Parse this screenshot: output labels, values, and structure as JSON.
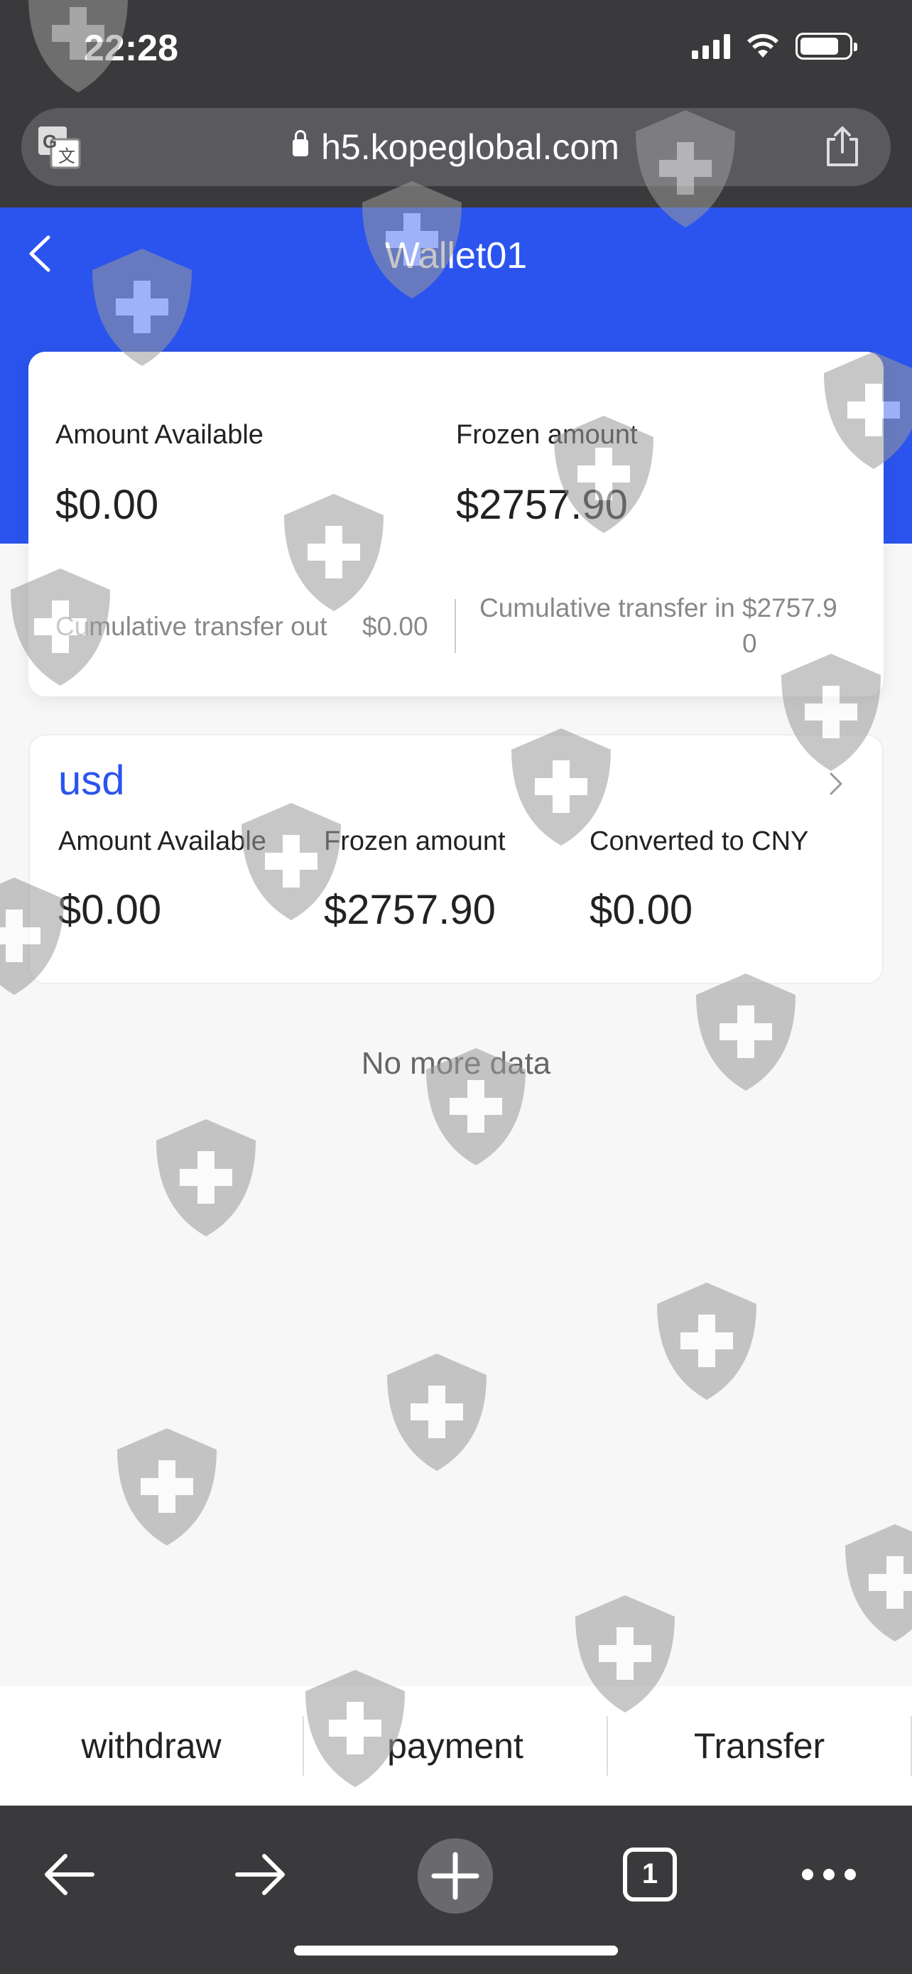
{
  "status_bar": {
    "time": "22:28"
  },
  "browser": {
    "url": "h5.kopeglobal.com",
    "tab_count": "1"
  },
  "header": {
    "title": "Wallet01"
  },
  "summary": {
    "available_label": "Amount Available",
    "available_value": "$0.00",
    "frozen_label": "Frozen amount",
    "frozen_value": "$2757.90",
    "transfer_out_label": "Cumulative transfer out",
    "transfer_out_value": "$0.00",
    "transfer_in_label": "Cumulative transfer in",
    "transfer_in_value": "$2757.90"
  },
  "currency_card": {
    "name": "usd",
    "available_label": "Amount Available",
    "available_value": "$0.00",
    "frozen_label": "Frozen amount",
    "frozen_value": "$2757.90",
    "cny_label": "Converted to CNY",
    "cny_value": "$0.00"
  },
  "list_end_text": "No more data",
  "actions": {
    "withdraw": "withdraw",
    "payment": "payment",
    "transfer": "Transfer"
  },
  "colors": {
    "brand_blue": "#2b54ee",
    "browser_chrome": "#3a3a3c"
  }
}
